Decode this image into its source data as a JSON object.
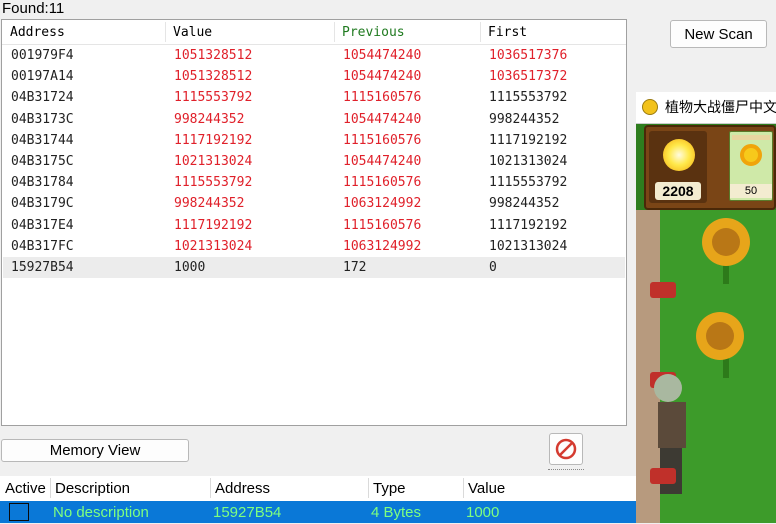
{
  "found_label": "Found:11",
  "new_scan_label": "New Scan",
  "results": {
    "columns": [
      "Address",
      "Value",
      "Previous",
      "First"
    ],
    "rows": [
      {
        "address": "001979F4",
        "value": "1051328512",
        "previous": "1054474240",
        "first": "1036517376",
        "changed": true
      },
      {
        "address": "00197A14",
        "value": "1051328512",
        "previous": "1054474240",
        "first": "1036517372",
        "changed": true
      },
      {
        "address": "04B31724",
        "value": "1115553792",
        "previous": "1115160576",
        "first": "1115553792",
        "changed": true
      },
      {
        "address": "04B3173C",
        "value": "998244352",
        "previous": "1054474240",
        "first": "998244352",
        "changed": true
      },
      {
        "address": "04B31744",
        "value": "1117192192",
        "previous": "1115160576",
        "first": "1117192192",
        "changed": true
      },
      {
        "address": "04B3175C",
        "value": "1021313024",
        "previous": "1054474240",
        "first": "1021313024",
        "changed": true
      },
      {
        "address": "04B31784",
        "value": "1115553792",
        "previous": "1115160576",
        "first": "1115553792",
        "changed": true
      },
      {
        "address": "04B3179C",
        "value": "998244352",
        "previous": "1063124992",
        "first": "998244352",
        "changed": true
      },
      {
        "address": "04B317E4",
        "value": "1117192192",
        "previous": "1115160576",
        "first": "1117192192",
        "changed": true
      },
      {
        "address": "04B317FC",
        "value": "1021313024",
        "previous": "1063124992",
        "first": "1021313024",
        "changed": true
      },
      {
        "address": "15927B54",
        "value": "1000",
        "previous": "172",
        "first": "0",
        "changed": false
      }
    ]
  },
  "memory_view_label": "Memory View",
  "address_list": {
    "columns": [
      "Active",
      "Description",
      "Address",
      "Type",
      "Value"
    ],
    "rows": [
      {
        "description": "No description",
        "address": "15927B54",
        "type": "4 Bytes",
        "value": "1000"
      }
    ]
  },
  "game": {
    "title": "植物大战僵尸中文",
    "sun": "2208",
    "card_cost": "50"
  },
  "colors": {
    "changed_value": "#e0202a",
    "previous_header": "#1f7a1f",
    "selection": "#0a78d7",
    "selected_text": "#7fff7f"
  },
  "icons": [
    "stop-scan-icon",
    "game-app-icon",
    "sun-icon",
    "sunflower-icon",
    "zombie-icon",
    "lawnmower-icon"
  ]
}
